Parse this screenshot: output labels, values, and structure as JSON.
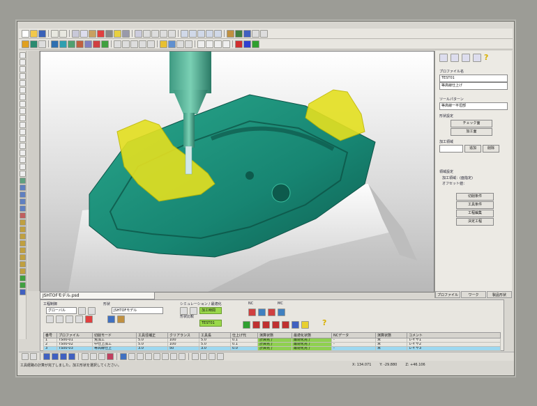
{
  "document_tab": "JSHTOFモデル.psd",
  "right_panel": {
    "process_file_label": "プロファイル名",
    "process_file_value": "TEST01",
    "process_file_desc": "等高線仕上げ",
    "toolpath_label": "ツールパターン",
    "toolpath_value": "等高線一平坦部",
    "shape_settings_label": "形状設定",
    "check_face": "チェック面",
    "machining_face": "加工面",
    "machining_area_label": "加工領域",
    "add_button": "追加",
    "delete_button": "削除",
    "area_set_label": "領域設定",
    "area_set_line1": "加工領域：(面指定)",
    "area_set_line2": "オフセット値：",
    "cutting_conditions": "切削条件",
    "tool_conditions": "工具条件",
    "profile_edit": "工程編集",
    "confirm": "決定工程",
    "tab_profile": "プロファイル",
    "tab_work": "ワーク",
    "tab_product": "製品形状"
  },
  "bottom_panel": {
    "process_label": "工程制御",
    "global_select": "グローバル",
    "shape_label": "形状",
    "model_name": "JSHTOFモデル",
    "sim_label": "シミュレーション / 最適化",
    "sim_value": "加工時間",
    "shape_compare_label": "形状比較",
    "compare_value": "TEST01",
    "nc_label": "NC",
    "mc_label": "MC",
    "headers": [
      "番号",
      "プロファイル",
      "切削モード",
      "工具径補正",
      "クリアランス",
      "工具長",
      "仕上げ代",
      "演算状態",
      "最適化状態",
      "NCデータ",
      "演算状態",
      "コメント"
    ],
    "rows": [
      [
        "1",
        "TS00-01",
        "荒加工",
        "5.0",
        "100",
        "5.0",
        "0.1",
        "計算完了",
        "最適化完了",
        "-",
        "未",
        "レイヤ1"
      ],
      [
        "2",
        "TS00-02",
        "中仕上加工",
        "5.0",
        "100",
        "5.0",
        "0.1",
        "計算完了",
        "最適化完了",
        "-",
        "未",
        "レイヤ2"
      ],
      [
        "3",
        "TS00-03",
        "等高線仕上",
        "3.0",
        "50",
        "3.0",
        "0.0",
        "計算完了",
        "最適化完了",
        "-",
        "未",
        "レイヤ3"
      ]
    ]
  },
  "status": {
    "message": "工具経路の計算が完了しました。加工形状を選択してください。",
    "x": "X: 134.071",
    "y": "Y: -29.880",
    "z": "Z: +46.106"
  },
  "colors": {
    "model": "#178572",
    "highlight": "#e4e020",
    "selection": "#9dd8f0",
    "ok_green": "#8fd050"
  }
}
